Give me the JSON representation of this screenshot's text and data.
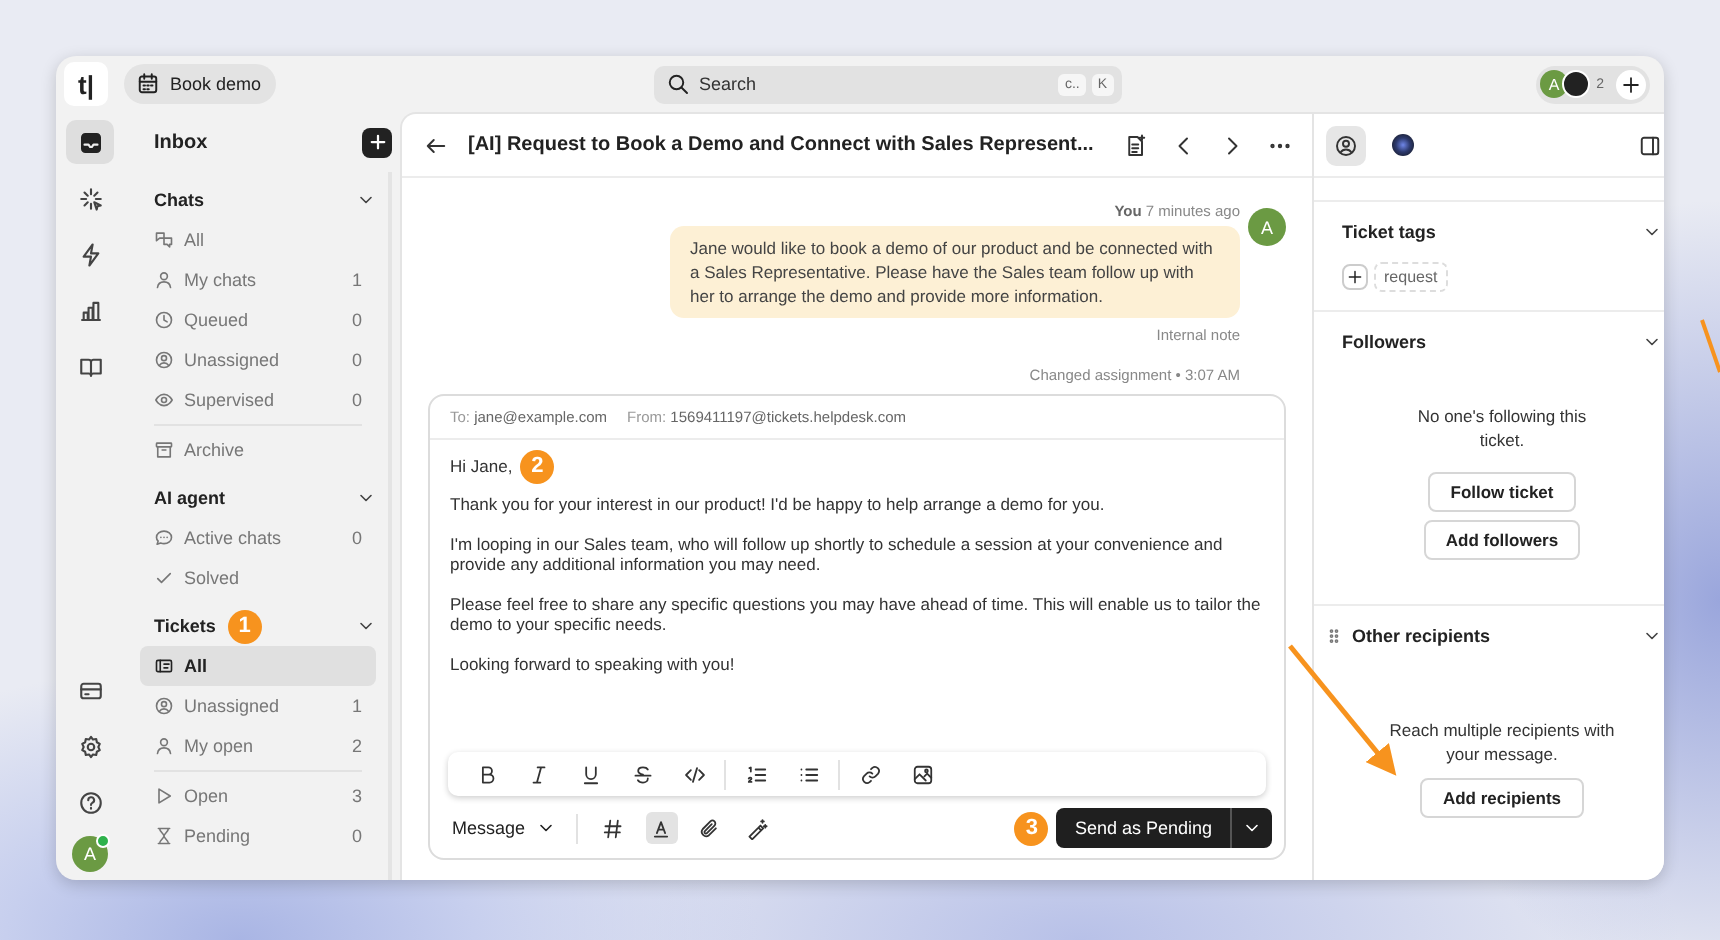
{
  "topbar": {
    "logo": "t|",
    "book_demo": "Book demo",
    "search": {
      "placeholder": "Search",
      "keys": [
        "c..",
        "K"
      ]
    },
    "avatar": "A",
    "agents_count": "2"
  },
  "rail": {
    "items": [
      {
        "kind": "inbox",
        "selected": true
      },
      {
        "kind": "sparkle",
        "selected": false
      },
      {
        "kind": "bolt",
        "selected": false
      },
      {
        "kind": "chart",
        "selected": false
      },
      {
        "kind": "book",
        "selected": false
      }
    ],
    "bottom": [
      {
        "kind": "card"
      },
      {
        "kind": "gear"
      },
      {
        "kind": "help"
      }
    ],
    "avatar": "A"
  },
  "sidebar": {
    "title": "Inbox",
    "sections": [
      {
        "title": "Chats",
        "expanded": true,
        "groups": [
          [
            {
              "kind": "chats",
              "label": "All",
              "selected": false
            },
            {
              "kind": "person",
              "label": "My chats",
              "count": "1",
              "selected": false
            },
            {
              "kind": "clock",
              "label": "Queued",
              "count": "0",
              "selected": false
            },
            {
              "kind": "user-circle",
              "label": "Unassigned",
              "count": "0",
              "selected": false
            },
            {
              "kind": "eye",
              "label": "Supervised",
              "count": "0",
              "selected": false
            }
          ],
          [
            {
              "kind": "archive",
              "label": "Archive",
              "selected": false
            }
          ]
        ]
      },
      {
        "title": "AI agent",
        "expanded": true,
        "groups": [
          [
            {
              "kind": "bubble",
              "label": "Active chats",
              "count": "0",
              "selected": false
            },
            {
              "kind": "check",
              "label": "Solved",
              "selected": false
            }
          ]
        ]
      },
      {
        "title": "Tickets",
        "marker": "1",
        "expanded": true,
        "groups": [
          [
            {
              "kind": "ticket",
              "label": "All",
              "selected": true
            },
            {
              "kind": "user-circle",
              "label": "Unassigned",
              "count": "1",
              "selected": false
            },
            {
              "kind": "person",
              "label": "My open",
              "count": "2",
              "selected": false
            }
          ],
          [
            {
              "kind": "play",
              "label": "Open",
              "count": "3",
              "selected": false
            },
            {
              "kind": "hourglass",
              "label": "Pending",
              "count": "0",
              "selected": false
            }
          ]
        ]
      }
    ]
  },
  "conversation": {
    "title": "[AI] Request to Book a Demo and Connect with Sales Represent...",
    "message": {
      "author": "You",
      "time": "7 minutes ago",
      "avatar": "A",
      "text": "Jane would like to book a demo of our product and be connected with a Sales Representative. Please have the Sales team follow up with her to arrange the demo and provide more information.",
      "note": "Internal note"
    },
    "event": "Changed assignment • 3:07 AM",
    "composer": {
      "to_label": "To:",
      "to": "jane@example.com",
      "from_label": "From:",
      "from": "1569411197@tickets.helpdesk.com",
      "greeting": "Hi Jane,",
      "marker": "2",
      "paragraphs": [
        "Thank you for your interest in our product! I'd be happy to help arrange a demo for you.",
        "I'm looping in our Sales team, who will follow up shortly to schedule a session at your convenience and provide any additional information you may need.",
        "Please feel free to share any specific questions you may have ahead of time. This will enable us to tailor the demo to your specific needs.",
        "Looking forward to speaking with you!"
      ],
      "format_tools": [
        {
          "kind": "bold"
        },
        {
          "kind": "italic"
        },
        {
          "kind": "underline"
        },
        {
          "kind": "strike"
        },
        {
          "kind": "code"
        },
        {
          "kind": "ordered"
        },
        {
          "kind": "bullets"
        },
        {
          "kind": "link"
        },
        {
          "kind": "image"
        }
      ],
      "mode": "Message",
      "tools": [
        {
          "kind": "hash",
          "selected": false
        },
        {
          "kind": "text",
          "selected": true
        },
        {
          "kind": "clip",
          "selected": false
        },
        {
          "kind": "wand",
          "selected": false
        }
      ],
      "send_marker": "3",
      "send": "Send as Pending"
    }
  },
  "details": {
    "tabs": [
      {
        "kind": "person",
        "selected": true
      },
      {
        "kind": "ai",
        "selected": false
      }
    ],
    "tags": {
      "title": "Ticket tags",
      "expanded": true,
      "items": [
        "request"
      ]
    },
    "followers": {
      "title": "Followers",
      "expanded": true,
      "empty": "No one's following this ticket.",
      "buttons": [
        "Follow ticket",
        "Add followers"
      ]
    },
    "recipients": {
      "title": "Other recipients",
      "expanded": true,
      "text": "Reach multiple recipients with your message.",
      "button": "Add recipients"
    }
  }
}
